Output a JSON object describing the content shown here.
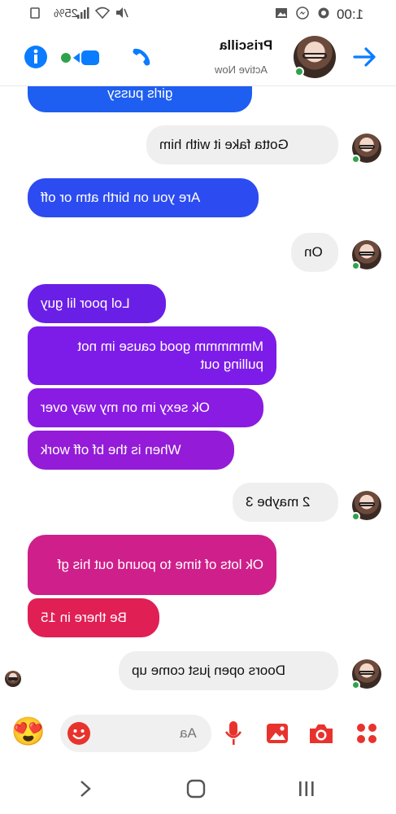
{
  "status_bar": {
    "time": "1:00",
    "battery": "25%"
  },
  "header": {
    "contact_name": "Priscilla",
    "contact_status": "Active Now"
  },
  "messages": [
    {
      "text": "girls pussy",
      "from": "me"
    },
    {
      "text": "Gotta fake it with him",
      "from": "them"
    },
    {
      "text": "Are you on birth atm or off",
      "from": "me"
    },
    {
      "text": "On",
      "from": "them"
    },
    {
      "text": "Lol poor lil guy",
      "from": "me"
    },
    {
      "text": "Mmmmmm good cause im not pulling out",
      "from": "me"
    },
    {
      "text": "Ok sexy im on my way over",
      "from": "me"
    },
    {
      "text": "When is the bf off work",
      "from": "me"
    },
    {
      "text": "2 maybe 3",
      "from": "them"
    },
    {
      "text": "Ok lots of time to pound out his gf",
      "from": "me"
    },
    {
      "text": "Be there in 15",
      "from": "me"
    },
    {
      "text": "Doors open just come up",
      "from": "them"
    }
  ],
  "composer": {
    "placeholder": "Aa",
    "emoji_button": "😍"
  },
  "colors": {
    "messenger_blue": "#0a7cff",
    "online_green": "#31a24c",
    "composer_red": "#e8332d",
    "incoming_bubble": "#efefef"
  },
  "icons": {
    "back": "arrow-icon",
    "call": "phone-icon",
    "video": "video-icon",
    "info": "info-icon"
  }
}
